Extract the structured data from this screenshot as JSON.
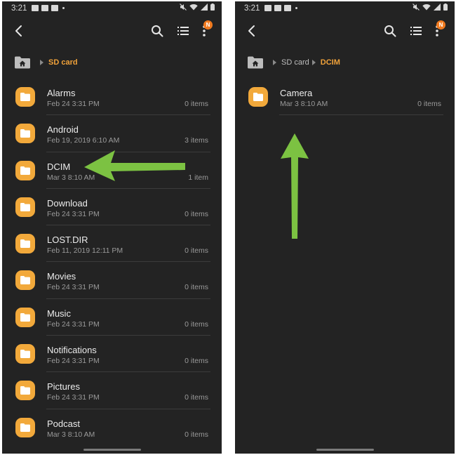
{
  "colors": {
    "background": "#232323",
    "accent": "#f0a23a",
    "folder": "#f2a93b",
    "badge": "#f07a1f",
    "arrow": "#7cc242"
  },
  "left_screen": {
    "status_time": "3:21",
    "badge": "N",
    "breadcrumb": [
      "SD card"
    ],
    "files": [
      {
        "name": "Alarms",
        "date": "Feb 24 3:31 PM",
        "count": "0 items"
      },
      {
        "name": "Android",
        "date": "Feb 19, 2019 6:10 AM",
        "count": "3 items"
      },
      {
        "name": "DCIM",
        "date": "Mar 3 8:10 AM",
        "count": "1 item"
      },
      {
        "name": "Download",
        "date": "Feb 24 3:31 PM",
        "count": "0 items"
      },
      {
        "name": "LOST.DIR",
        "date": "Feb 11, 2019 12:11 PM",
        "count": "0 items"
      },
      {
        "name": "Movies",
        "date": "Feb 24 3:31 PM",
        "count": "0 items"
      },
      {
        "name": "Music",
        "date": "Feb 24 3:31 PM",
        "count": "0 items"
      },
      {
        "name": "Notifications",
        "date": "Feb 24 3:31 PM",
        "count": "0 items"
      },
      {
        "name": "Pictures",
        "date": "Feb 24 3:31 PM",
        "count": "0 items"
      },
      {
        "name": "Podcast",
        "date": "Mar 3 8:10 AM",
        "count": "0 items"
      }
    ]
  },
  "right_screen": {
    "status_time": "3:21",
    "badge": "N",
    "breadcrumb": [
      "SD card",
      "DCIM"
    ],
    "files": [
      {
        "name": "Camera",
        "date": "Mar 3 8:10 AM",
        "count": "0 items"
      }
    ]
  }
}
